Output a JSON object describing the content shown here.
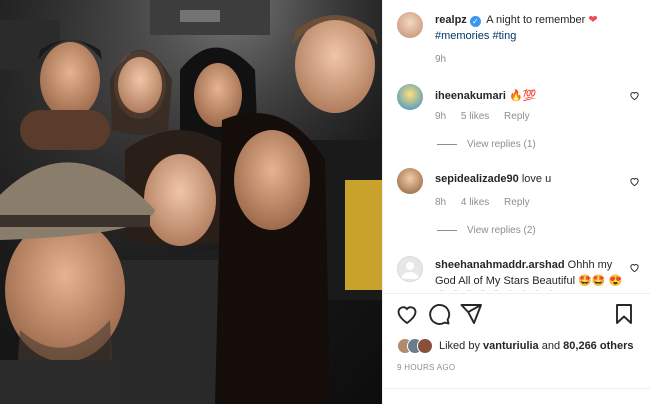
{
  "post": {
    "author": "realpz",
    "caption_text": "A night to remember",
    "hashtags": "#memories #ting",
    "age": "9h"
  },
  "comments": [
    {
      "user": "iheenakumari",
      "text": "🔥💯",
      "age": "9h",
      "likes": "5 likes",
      "reply": "Reply",
      "view_replies": "View replies (1)"
    },
    {
      "user": "sepidealizade90",
      "text": "love u",
      "age": "8h",
      "likes": "4 likes",
      "reply": "Reply",
      "view_replies": "View replies (2)"
    },
    {
      "user": "sheehanahmaddr.arshad",
      "text": "Ohhh my God All of My Stars Beautiful 🤩🤩",
      "extra": "😍😍😍😍😍😍🙏🙏🙏🙏"
    }
  ],
  "liked_by": {
    "prefix": "Liked by",
    "user": "vanturiulia",
    "and": "and",
    "others": "80,266 others"
  },
  "timestamp": "9 HOURS AGO",
  "icons": [
    "heart-icon",
    "comment-icon",
    "share-icon",
    "bookmark-icon",
    "verified-badge-icon"
  ],
  "colors": {
    "verified": "#3897f0",
    "hashtag": "#00376b",
    "heart_red": "#ed4956"
  }
}
